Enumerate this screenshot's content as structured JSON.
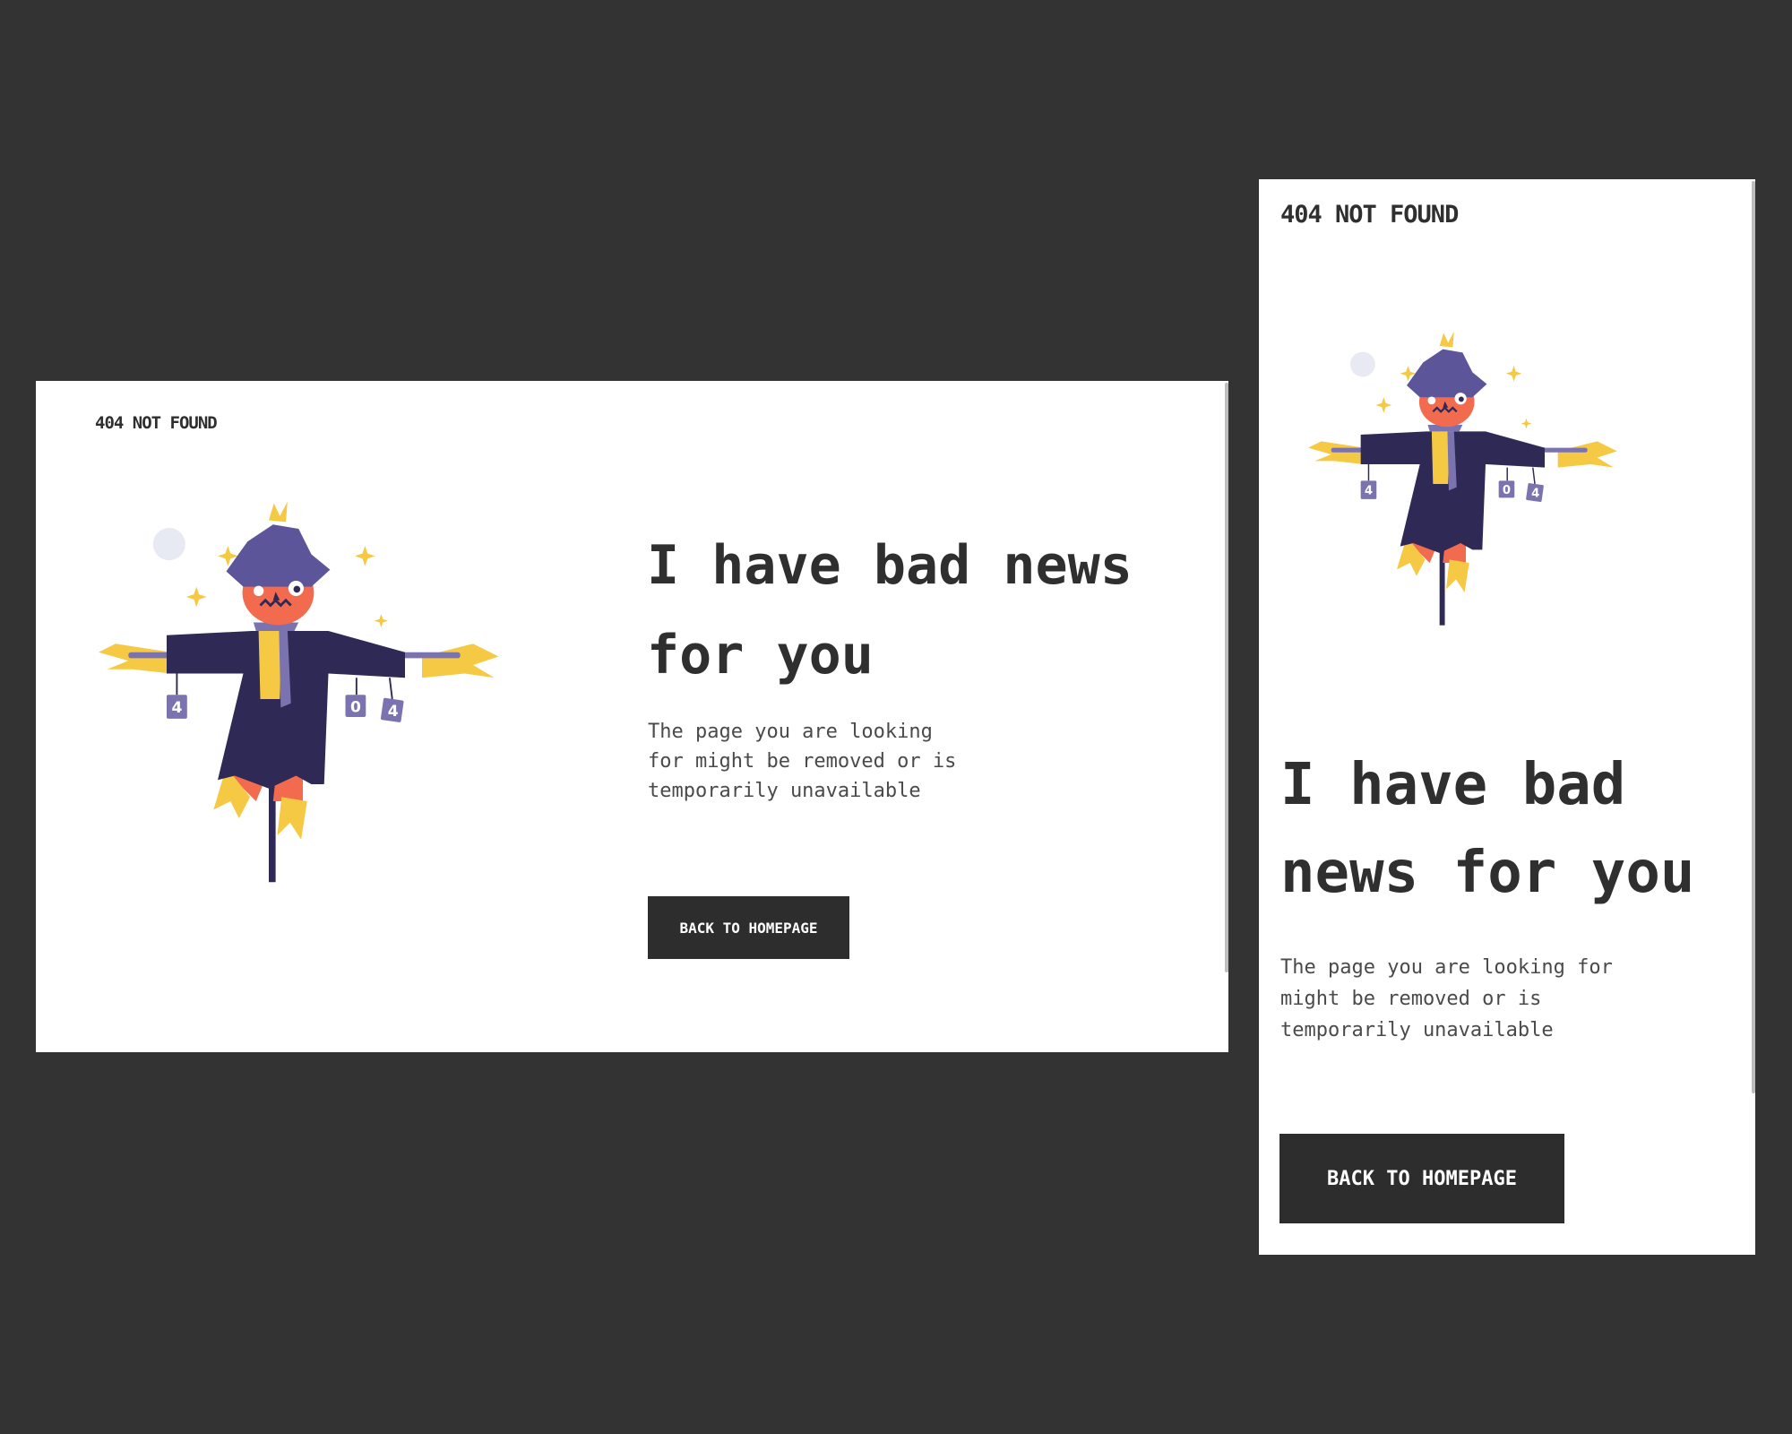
{
  "brand": "404 NOT FOUND",
  "headline": "I have bad news for you",
  "description": "The page you are looking for might be removed or is temporarily unavailable",
  "button_label": "BACK TO HOMEPAGE",
  "can_labels": [
    "4",
    "0",
    "4"
  ],
  "colors": {
    "background": "#333333",
    "card": "#ffffff",
    "text": "#2f2f2f",
    "button": "#2d2d2d",
    "coat": "#2e2a55",
    "face": "#f26b4f",
    "hat": "#5c5599",
    "straw": "#f6c944",
    "moon": "#e8eaf3"
  }
}
